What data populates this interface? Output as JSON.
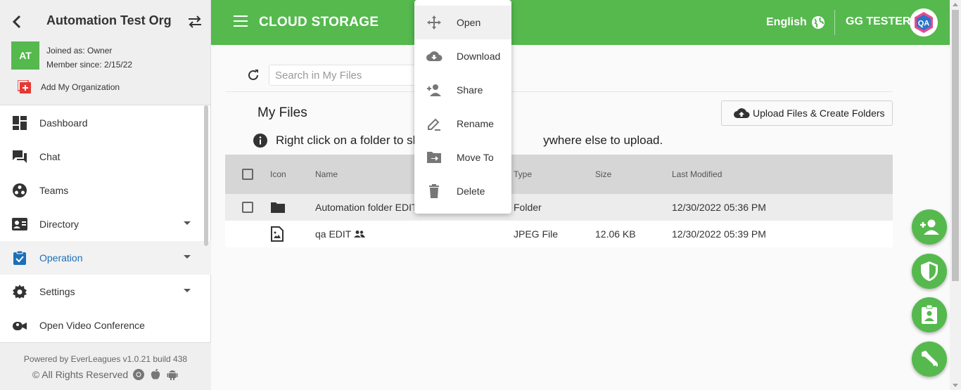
{
  "sidebar": {
    "org_name": "Automation Test Org",
    "avatar_initials": "AT",
    "joined_as": "Joined as: Owner",
    "member_since": "Member since: 2/15/22",
    "add_org_label": "Add My Organization",
    "items": [
      {
        "label": "Dashboard",
        "icon": "dashboard-icon"
      },
      {
        "label": "Chat",
        "icon": "chat-icon"
      },
      {
        "label": "Teams",
        "icon": "teams-icon"
      },
      {
        "label": "Directory",
        "icon": "directory-icon",
        "expandable": true
      },
      {
        "label": "Operation",
        "icon": "operation-icon",
        "expandable": true,
        "active": true
      },
      {
        "label": "Settings",
        "icon": "settings-icon",
        "expandable": true
      },
      {
        "label": "Open Video Conference",
        "icon": "video-icon"
      }
    ],
    "footer_line1": "Powered by EverLeagues v1.0.21 build 438",
    "footer_line2": "© All Rights Reserved"
  },
  "topbar": {
    "title": "CLOUD STORAGE",
    "language": "English",
    "user_name": "GG TESTER",
    "user_avatar": "QA"
  },
  "main": {
    "search_placeholder": "Search in My Files",
    "page_title": "My Files",
    "upload_label": "Upload Files & Create Folders",
    "info_text": "Right click on a folder to sh",
    "info_text_tail": "ywhere else to upload.",
    "columns": {
      "icon": "Icon",
      "name": "Name",
      "type": "Type",
      "size": "Size",
      "modified": "Last Modified"
    },
    "rows": [
      {
        "name": "Automation folder EDIT",
        "type": "Folder",
        "size": "",
        "modified": "12/30/2022 05:36 PM"
      },
      {
        "name": "qa EDIT",
        "type": "JPEG File",
        "size": "12.06 KB",
        "modified": "12/30/2022 05:39 PM"
      }
    ]
  },
  "context_menu": {
    "items": [
      "Open",
      "Download",
      "Share",
      "Rename",
      "Move To",
      "Delete"
    ]
  },
  "colors": {
    "brand_green": "#55b94e",
    "active_blue": "#1d6fb8",
    "add_org_red": "#e53935"
  }
}
